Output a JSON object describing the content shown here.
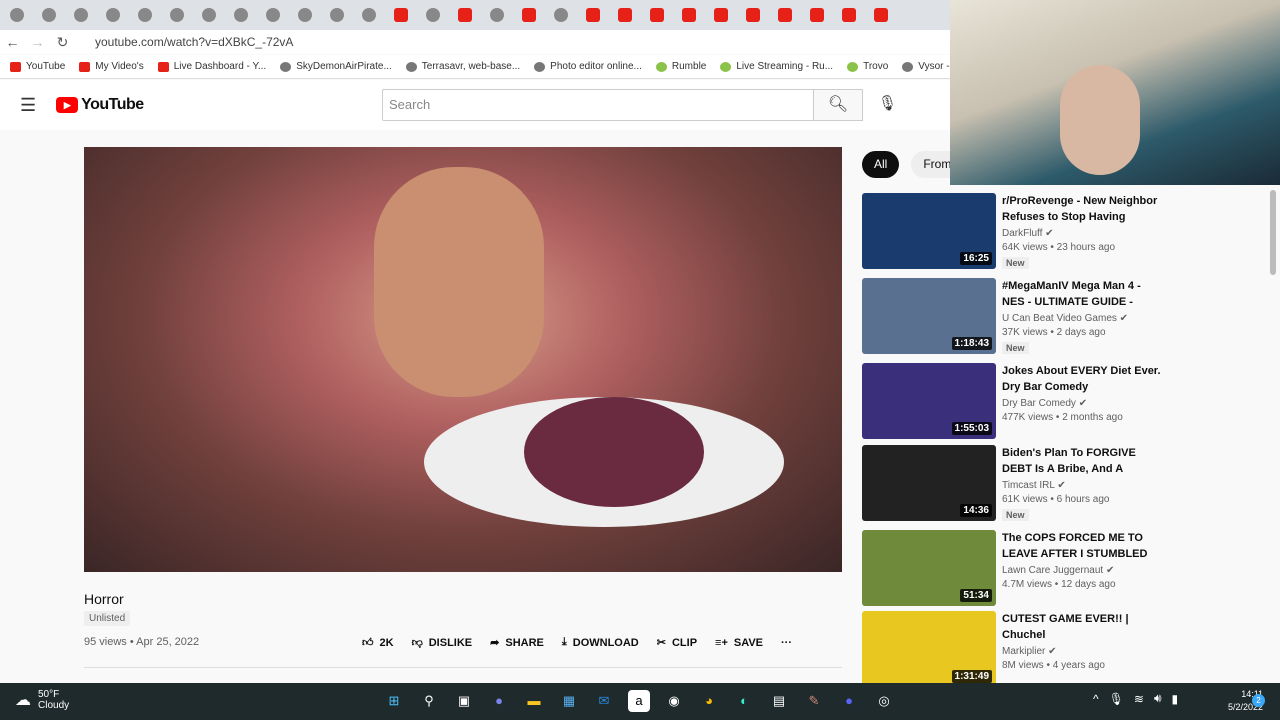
{
  "browser": {
    "url": "youtube.com/watch?v=dXBkC_-72vA",
    "bookmarks": [
      "YouTube",
      "My Video's",
      "Live Dashboard - Y...",
      "SkyDemonAirPirate...",
      "Terrasavr, web-base...",
      "Photo editor online...",
      "Rumble",
      "Live Streaming - Ru...",
      "Trovo",
      "Vysor - Ch"
    ]
  },
  "header": {
    "logo": "YouTube",
    "search_placeholder": "Search"
  },
  "video": {
    "title": "Horror",
    "badge": "Unlisted",
    "meta": "95 views • Apr 25, 2022",
    "actions": {
      "like": "2K",
      "dislike": "DISLIKE",
      "share": "SHARE",
      "download": "DOWNLOAD",
      "clip": "CLIP",
      "save": "SAVE"
    }
  },
  "chips": [
    "All",
    "From M"
  ],
  "recommendations": [
    {
      "title": "r/ProRevenge - New Neighbor Refuses to Stop Having LOUD...",
      "channel": "DarkFluff",
      "views": "64K views • 23 hours ago",
      "badge": "New",
      "duration": "16:25",
      "color": "#1a3b6e"
    },
    {
      "title": "#MegaManIV Mega Man 4 - NES - ULTIMATE GUIDE - ALL...",
      "channel": "U Can Beat Video Games",
      "views": "37K views • 2 days ago",
      "badge": "New",
      "duration": "1:18:43",
      "color": "#5a7090"
    },
    {
      "title": "Jokes About EVERY Diet Ever. Dry Bar Comedy",
      "channel": "Dry Bar Comedy",
      "views": "477K views • 2 months ago",
      "badge": null,
      "duration": "1:55:03",
      "color": "#3a2f7a"
    },
    {
      "title": "Biden's Plan To FORGIVE DEBT Is A Bribe, And A Distraction...",
      "channel": "Timcast IRL",
      "views": "61K views • 6 hours ago",
      "badge": "New",
      "duration": "14:36",
      "color": "#222"
    },
    {
      "title": "The COPS FORCED ME TO LEAVE AFTER I STUMBLED O...",
      "channel": "Lawn Care Juggernaut",
      "views": "4.7M views • 12 days ago",
      "badge": null,
      "duration": "51:34",
      "color": "#6f8a3a"
    },
    {
      "title": "CUTEST GAME EVER!! | Chuchel",
      "channel": "Markiplier",
      "views": "8M views • 4 years ago",
      "badge": null,
      "duration": "1:31:49",
      "color": "#e8c820"
    }
  ],
  "taskbar": {
    "temp": "50°F",
    "weather": "Cloudy",
    "time": "14:11",
    "date": "5/2/2022",
    "notifications": "2"
  }
}
